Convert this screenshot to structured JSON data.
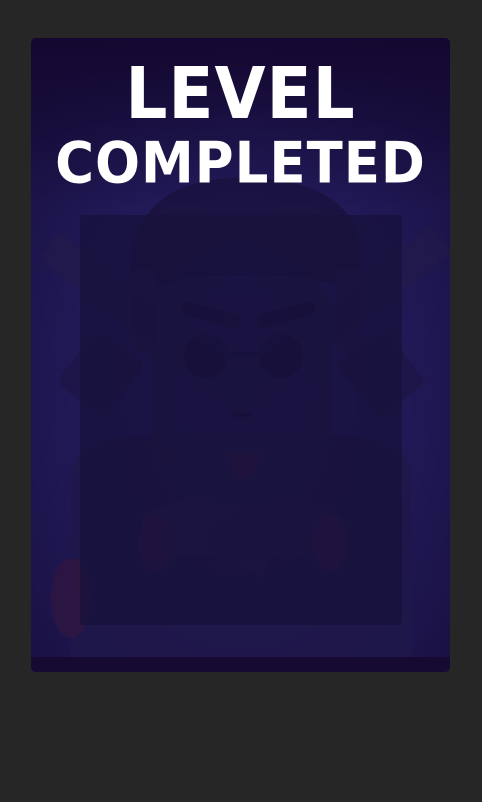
{
  "screen": {
    "title_line_1": "LEVEL",
    "title_line_2": "COMPLETED"
  },
  "character": {
    "description_icon": "hitman-character-with-crossed-guns"
  },
  "colors": {
    "page_background": "#262626",
    "card_background": "#15082f",
    "title_text": "#ffffff"
  }
}
